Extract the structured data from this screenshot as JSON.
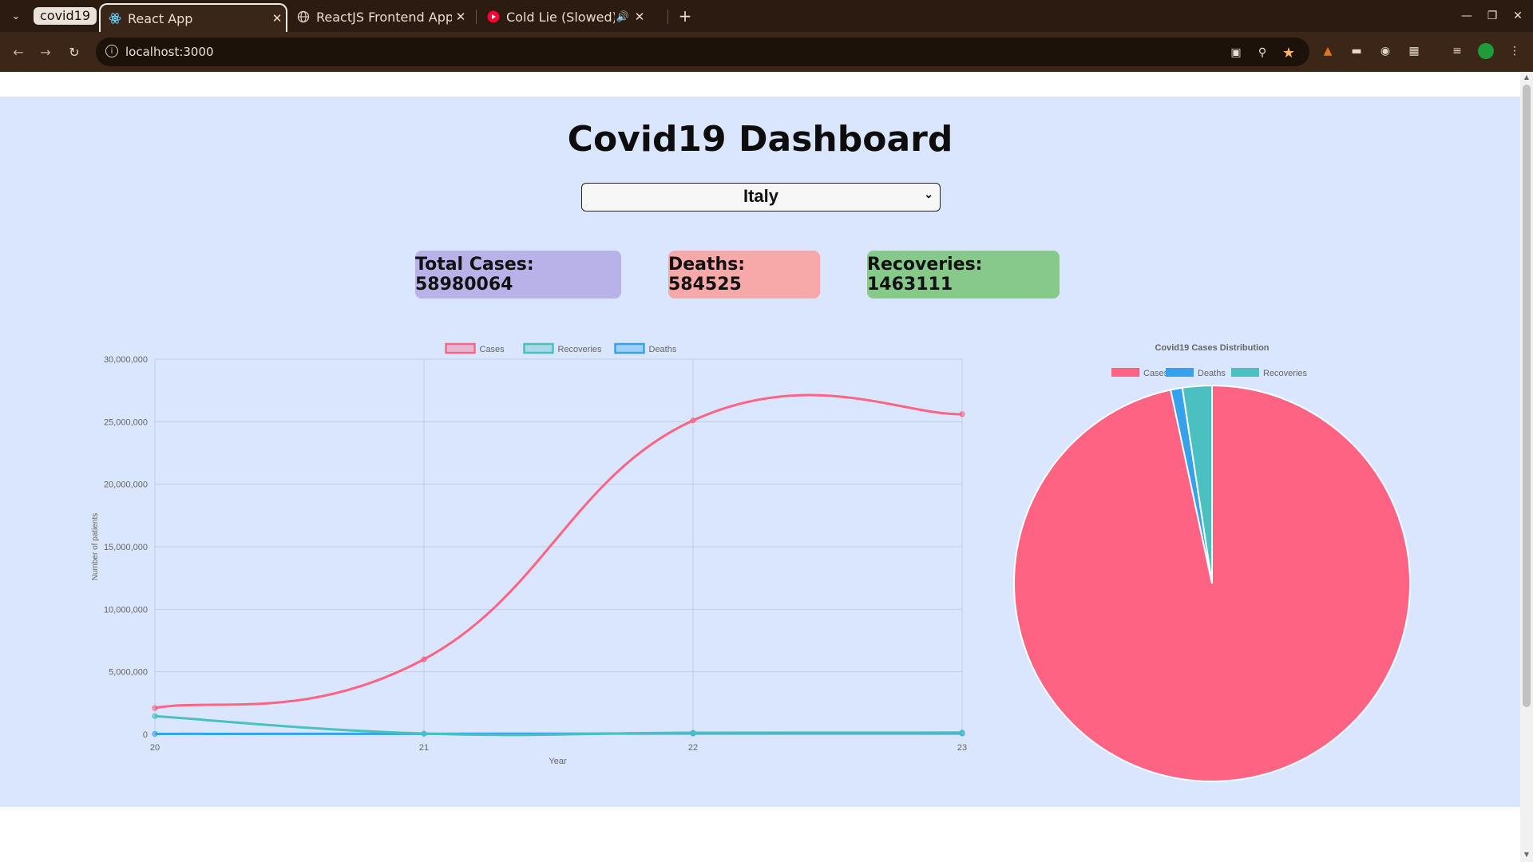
{
  "browser": {
    "tab_group": "covid19",
    "tabs": [
      {
        "title": "React App",
        "active": true
      },
      {
        "title": "ReactJS Frontend App",
        "active": false
      },
      {
        "title": "Cold Lie (Slowed) - Y",
        "active": false
      }
    ],
    "url": "localhost:3000"
  },
  "page": {
    "title": "Covid19 Dashboard",
    "selected_country": "Italy",
    "stats": {
      "total_cases": "Total Cases: 58980064",
      "deaths": "Deaths: 584525",
      "recoveries": "Recoveries: 1463111"
    }
  },
  "colors": {
    "cases": "#ff6384",
    "deaths": "#36a2eb",
    "recoveries": "#4bc0c0",
    "page_bg": "#d9e6fd",
    "total_cases_box": "#b8b2e8",
    "deaths_box": "#f7a8a8",
    "recoveries_box": "#86c98a"
  },
  "chart_data": [
    {
      "type": "line",
      "title": "",
      "xlabel": "Year",
      "ylabel": "Number of patients",
      "x": [
        "20",
        "21",
        "22",
        "23"
      ],
      "ylim": [
        0,
        30000000
      ],
      "y_ticks": [
        "0",
        "5,000,000",
        "10,000,000",
        "15,000,000",
        "20,000,000",
        "25,000,000",
        "30,000,000"
      ],
      "grid": true,
      "legend": "top-center",
      "series": [
        {
          "name": "Cases",
          "color": "#ff6384",
          "values": [
            2100000,
            6000000,
            25100000,
            25600000
          ]
        },
        {
          "name": "Recoveries",
          "color": "#4bc0c0",
          "values": [
            1450000,
            60000,
            130000,
            140000
          ]
        },
        {
          "name": "Deaths",
          "color": "#36a2eb",
          "values": [
            35000,
            40000,
            60000,
            60000
          ]
        }
      ]
    },
    {
      "type": "pie",
      "title": "Covid19 Cases Distribution",
      "legend": "top-center",
      "labels": [
        "Cases",
        "Deaths",
        "Recoveries"
      ],
      "values": [
        58980064,
        584525,
        1463111
      ],
      "colors": [
        "#ff6384",
        "#36a2eb",
        "#4bc0c0"
      ]
    }
  ]
}
